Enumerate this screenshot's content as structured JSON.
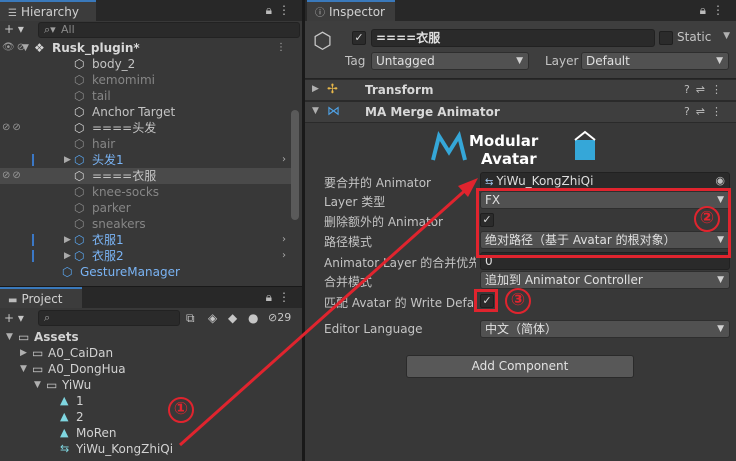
{
  "hierarchy": {
    "tab_label": "Hierarchy",
    "search_placeholder": "All",
    "root": "Rusk_plugin*",
    "rows": [
      {
        "label": "body_2",
        "dim": false,
        "blue": false
      },
      {
        "label": "kemomimi",
        "dim": true,
        "blue": false
      },
      {
        "label": "tail",
        "dim": true,
        "blue": false
      },
      {
        "label": "Anchor Target",
        "dim": false,
        "blue": false
      },
      {
        "label": "====头发",
        "dim": false,
        "blue": false
      },
      {
        "label": "hair",
        "dim": true,
        "blue": false
      },
      {
        "label": "头发1",
        "dim": false,
        "blue": true
      },
      {
        "label": "====衣服",
        "dim": false,
        "blue": false
      },
      {
        "label": "knee-socks",
        "dim": true,
        "blue": false
      },
      {
        "label": "parker",
        "dim": true,
        "blue": false
      },
      {
        "label": "sneakers",
        "dim": true,
        "blue": false
      },
      {
        "label": "衣服1",
        "dim": false,
        "blue": true
      },
      {
        "label": "衣服2",
        "dim": false,
        "blue": true
      },
      {
        "label": "GestureManager",
        "dim": false,
        "blue": true
      }
    ]
  },
  "project": {
    "tab_label": "Project",
    "hidden_count": "29",
    "tree": [
      {
        "label": "Assets",
        "bold": true
      },
      {
        "label": "A0_CaiDan",
        "bold": false
      },
      {
        "label": "A0_DongHua",
        "bold": false
      },
      {
        "label": "YiWu",
        "bold": false
      },
      {
        "label": "1",
        "bold": false
      },
      {
        "label": "2",
        "bold": false
      },
      {
        "label": "MoRen",
        "bold": false
      },
      {
        "label": "YiWu_KongZhiQi",
        "bold": false
      }
    ]
  },
  "inspector": {
    "tab_label": "Inspector",
    "object_name": "====衣服",
    "static_label": "Static",
    "tag_label": "Tag",
    "tag_value": "Untagged",
    "layer_label": "Layer",
    "layer_value": "Default",
    "components": {
      "transform": "Transform",
      "merge_animator": "MA Merge Animator"
    },
    "logo_line1": "Modular",
    "logo_line2": "Avatar",
    "fields": {
      "animator_label": "要合并的 Animator",
      "animator_value": "YiWu_KongZhiQi",
      "layer_type_label": "Layer 类型",
      "layer_type_value": "FX",
      "delete_extra_label": "删除额外的 Animator",
      "path_mode_label": "路径模式",
      "path_mode_value": "绝对路径（基于 Avatar 的根对象）",
      "priority_label": "Animator Layer 的合并优先级",
      "priority_value": "0",
      "merge_mode_label": "合并模式",
      "merge_mode_value": "追加到 Animator Controller",
      "write_defaults_label": "匹配 Avatar 的 Write Defaults",
      "editor_language_label": "Editor Language",
      "editor_language_value": "中文（简体）"
    },
    "add_component": "Add Component"
  },
  "annotations": {
    "step1": "①",
    "step2": "②",
    "step3": "③"
  },
  "colors": {
    "annotation_red": "#e0242e",
    "accent_blue": "#3a79bb",
    "panel_bg": "#383838"
  }
}
